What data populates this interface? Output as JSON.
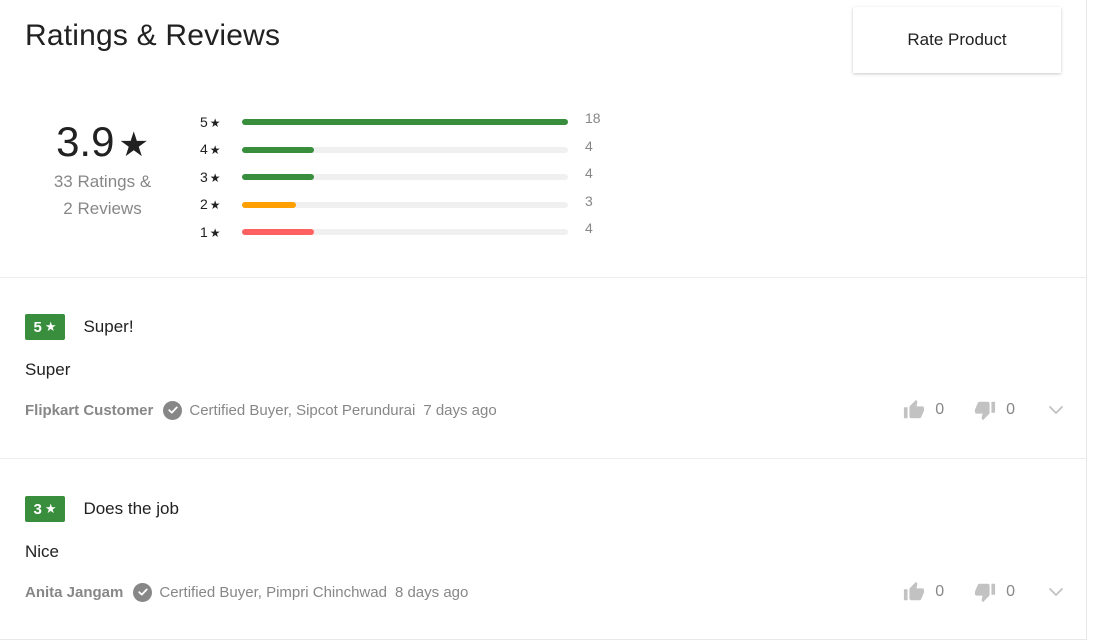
{
  "header": {
    "title": "Ratings & Reviews",
    "rate_button_label": "Rate Product"
  },
  "summary": {
    "average": "3.9",
    "star": "★",
    "ratings_line": "33 Ratings &",
    "reviews_line": "2 Reviews"
  },
  "distribution": [
    {
      "stars": "5",
      "count": "18",
      "fraction": 1.0,
      "color": "#388e3c"
    },
    {
      "stars": "4",
      "count": "4",
      "fraction": 0.222,
      "color": "#388e3c"
    },
    {
      "stars": "3",
      "count": "4",
      "fraction": 0.222,
      "color": "#388e3c"
    },
    {
      "stars": "2",
      "count": "3",
      "fraction": 0.167,
      "color": "#ff9f00"
    },
    {
      "stars": "1",
      "count": "4",
      "fraction": 0.222,
      "color": "#ff6161"
    }
  ],
  "reviews": [
    {
      "rating": "5",
      "title": "Super!",
      "body": "Super",
      "author": "Flipkart Customer",
      "certified": "Certified Buyer, Sipcot Perundurai",
      "ago": "7 days ago",
      "likes": "0",
      "dislikes": "0"
    },
    {
      "rating": "3",
      "title": "Does the job",
      "body": "Nice",
      "author": "Anita Jangam",
      "certified": "Certified Buyer, Pimpri Chinchwad",
      "ago": "8 days ago",
      "likes": "0",
      "dislikes": "0"
    }
  ],
  "colors": {
    "accent_green": "#388e3c",
    "muted_text": "#878787",
    "bar_track": "#f0f0f0"
  },
  "icons": {
    "verified": "check-circle-icon",
    "like": "thumbs-up-icon",
    "dislike": "thumbs-down-icon",
    "expand": "chevron-down-icon"
  }
}
